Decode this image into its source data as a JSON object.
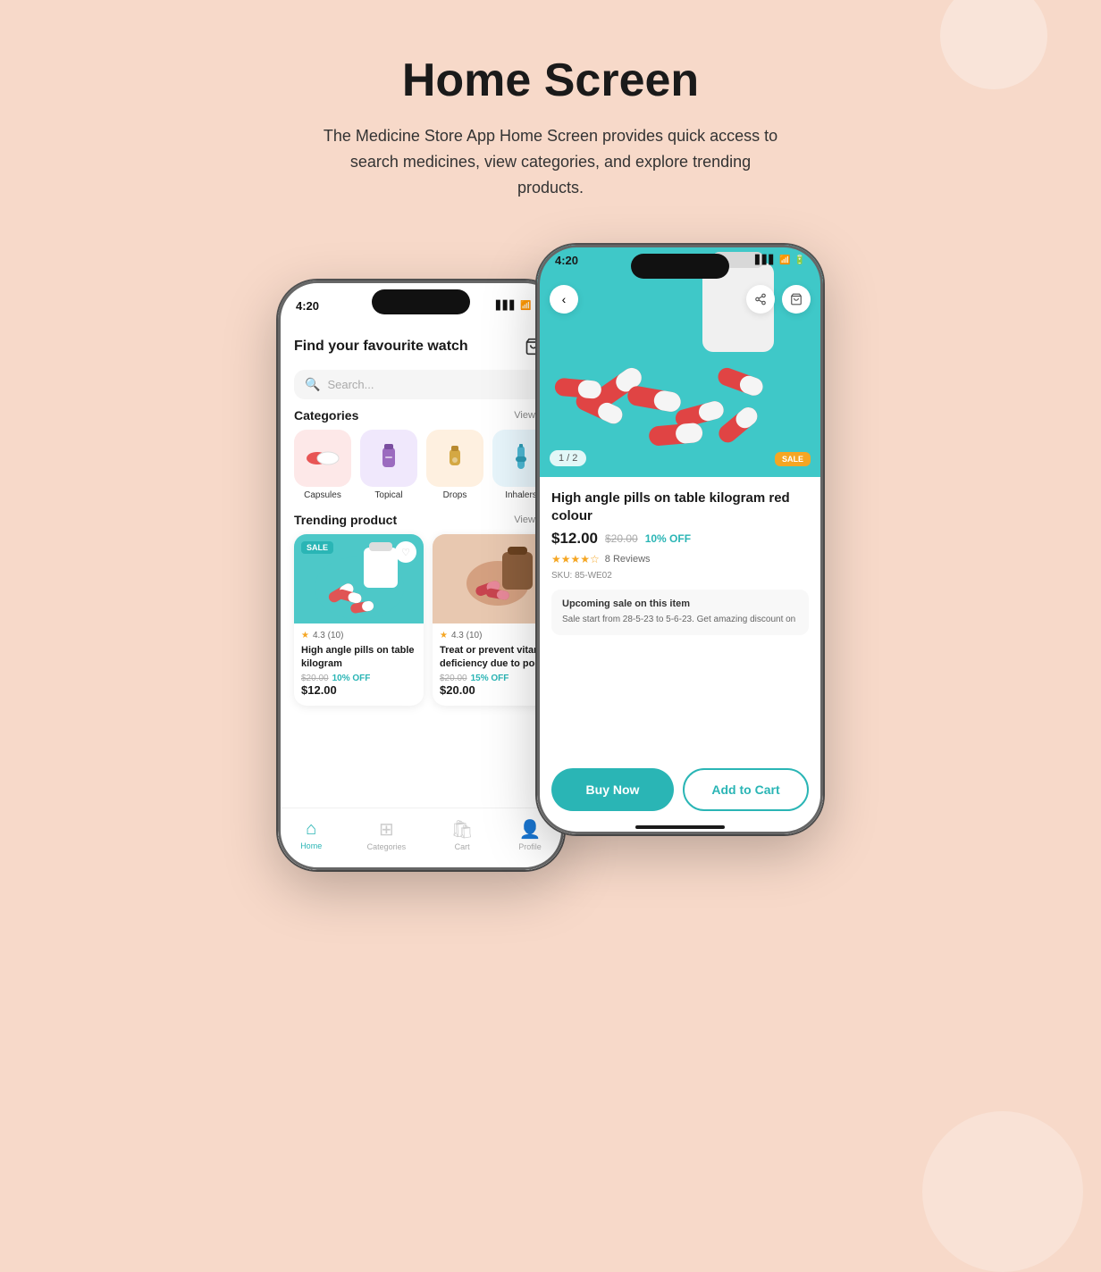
{
  "page": {
    "title": "Home Screen",
    "subtitle": "The Medicine Store App Home Screen provides quick access to search medicines, view categories, and explore trending products."
  },
  "phone1": {
    "status_time": "4:20",
    "header_title": "Find your favourite watch",
    "search_placeholder": "Search...",
    "categories_label": "Categories",
    "view_all_categories": "View all",
    "categories": [
      {
        "name": "Capsules",
        "emoji": "💊",
        "bg": "cat-capsules"
      },
      {
        "name": "Topical",
        "emoji": "🧴",
        "bg": "cat-topical"
      },
      {
        "name": "Drops",
        "emoji": "💧",
        "bg": "cat-drops"
      },
      {
        "name": "Inhalers",
        "emoji": "🫁",
        "bg": "cat-inhalers"
      }
    ],
    "trending_label": "Trending product",
    "view_all_trending": "View all",
    "products": [
      {
        "name": "High angle pills on table kilogram",
        "rating": "4.3 (10)",
        "original_price": "$20.00",
        "discount": "10% OFF",
        "current_price": "$12.00",
        "sale": true
      },
      {
        "name": "Treat or prevent vitamin deficiency due to poor",
        "rating": "4.3 (10)",
        "original_price": "$20.00",
        "discount": "15% OFF",
        "current_price": "$20.00",
        "sale": false
      }
    ],
    "nav": [
      {
        "label": "Home",
        "active": true
      },
      {
        "label": "Categories",
        "active": false
      },
      {
        "label": "Cart",
        "active": false
      },
      {
        "label": "Profile",
        "active": false
      }
    ]
  },
  "phone2": {
    "status_time": "4:20",
    "image_counter": "1 / 2",
    "sale_badge": "SALE",
    "product_name": "High angle pills on table kilogram red colour",
    "current_price": "$12.00",
    "original_price": "$20.00",
    "discount": "10% OFF",
    "rating": "★★★★☆",
    "reviews": "8 Reviews",
    "sku": "SKU: 85-WE02",
    "upcoming_label": "Upcoming sale on this item",
    "upcoming_text": "Sale start from 28-5-23 to 5-6-23. Get amazing discount on",
    "buy_now": "Buy Now",
    "add_to_cart": "Add to Cart"
  }
}
